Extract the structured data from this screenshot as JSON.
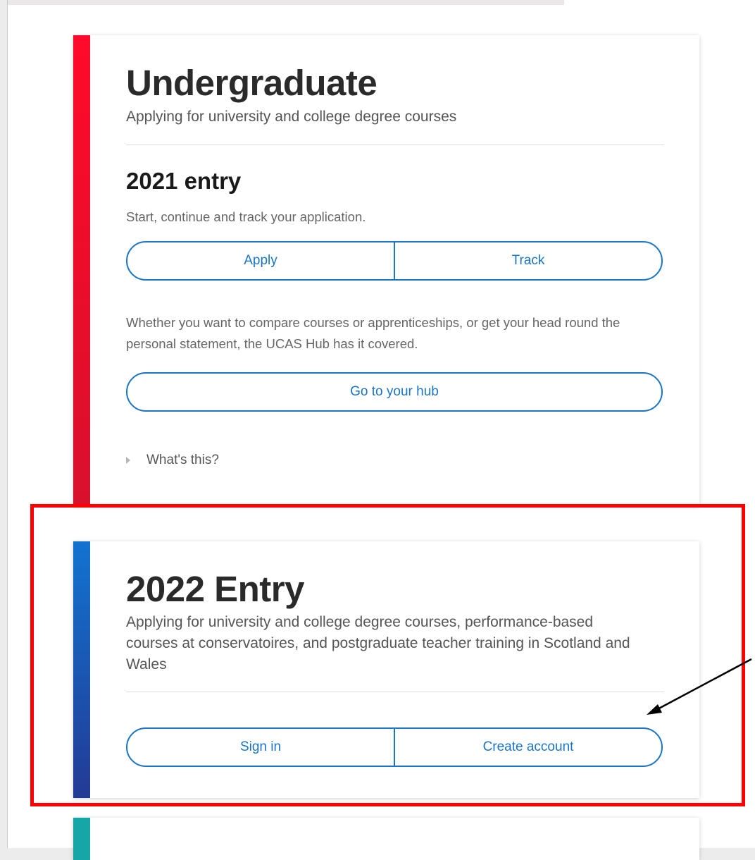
{
  "undergraduate": {
    "title": "Undergraduate",
    "subtitle": "Applying for university and college degree courses",
    "entry_2021": {
      "heading": "2021 entry",
      "description": "Start, continue and track your application.",
      "apply_label": "Apply",
      "track_label": "Track"
    },
    "hub_text": "Whether you want to compare courses or apprenticeships, or get your head round the personal statement, the UCAS Hub has it covered.",
    "hub_button_label": "Go to your hub",
    "whats_this_label": "What's this?"
  },
  "entry_2022": {
    "title": "2022 Entry",
    "subtitle": "Applying for university and college degree courses, performance-based courses at conservatoires, and postgraduate teacher training in Scotland and Wales",
    "sign_in_label": "Sign in",
    "create_account_label": "Create account"
  },
  "colors": {
    "undergraduate_stripe": "#ff0a2a",
    "entry_2022_stripe": "#1273d0",
    "third_card_stripe": "#17a6a8",
    "button_accent": "#1a74c7",
    "highlight_box": "#ff0000",
    "annotation_arrow": "#000000"
  },
  "icons": {
    "disclosure": "disclosure-triangle-icon",
    "annotation": "arrow-icon"
  }
}
